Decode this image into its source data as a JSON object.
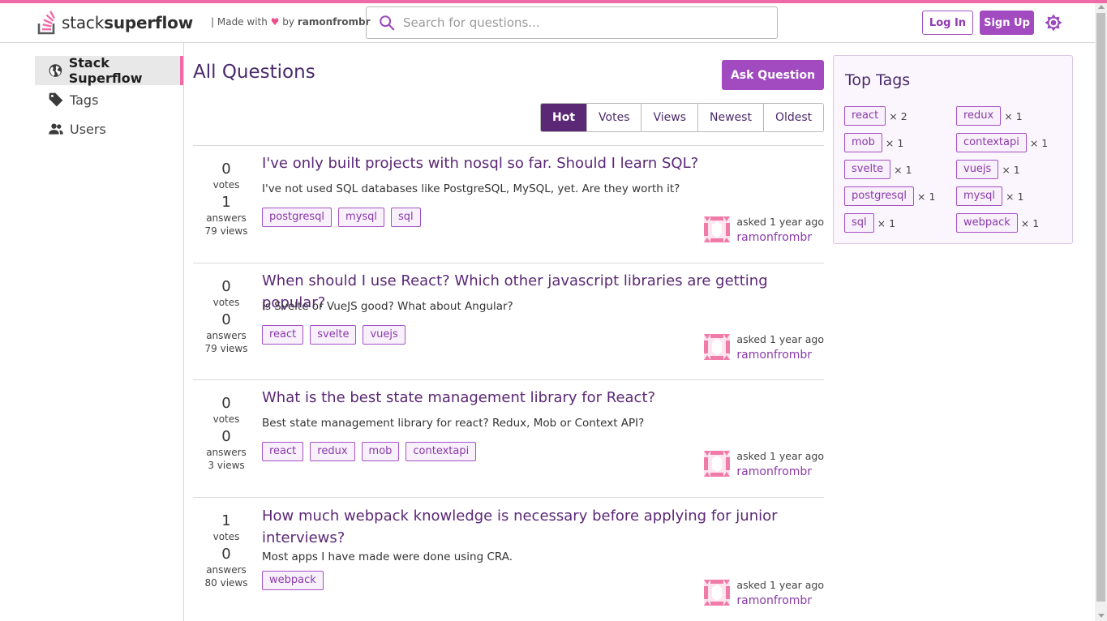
{
  "brand": {
    "name_light": "stack",
    "name_bold": "superflow",
    "made_with_prefix": "| Made with",
    "heart": "♥",
    "by": "by",
    "author": "ramonfrombr"
  },
  "search": {
    "placeholder": "Search for questions..."
  },
  "auth": {
    "login": "Log In",
    "signup": "Sign Up"
  },
  "icons": {
    "logo": "stack-logo-icon",
    "search": "search-icon",
    "theme": "brightness-icon",
    "globe": "globe-icon",
    "tag": "tag-icon",
    "users": "users-icon"
  },
  "colors": {
    "accent": "#a24bc0",
    "pink": "#f06aa8",
    "dark_purple": "#5b2876"
  },
  "sidebar": {
    "items": [
      {
        "label": "Stack Superflow"
      },
      {
        "label": "Tags"
      },
      {
        "label": "Users"
      }
    ]
  },
  "main": {
    "title": "All Questions",
    "ask_button": "Ask Question",
    "sort": [
      "Hot",
      "Votes",
      "Views",
      "Newest",
      "Oldest"
    ],
    "sort_active": "Hot",
    "questions": [
      {
        "votes": "0",
        "votes_label": "votes",
        "answers": "1",
        "answers_label": "answers",
        "views": "79 views",
        "title": "I've only built projects with nosql so far. Should I learn SQL?",
        "body": "I've not used SQL databases like PostgreSQL, MySQL, yet. Are they worth it?",
        "tags": [
          "postgresql",
          "mysql",
          "sql"
        ],
        "asked": "asked 1 year ago",
        "user": "ramonfrombr"
      },
      {
        "votes": "0",
        "votes_label": "votes",
        "answers": "0",
        "answers_label": "answers",
        "views": "79 views",
        "title": "When should I use React? Which other javascript libraries are getting popular?",
        "body": "Is Svelte or VueJS good? What about Angular?",
        "tags": [
          "react",
          "svelte",
          "vuejs"
        ],
        "asked": "asked 1 year ago",
        "user": "ramonfrombr"
      },
      {
        "votes": "0",
        "votes_label": "votes",
        "answers": "0",
        "answers_label": "answers",
        "views": "3 views",
        "title": "What is the best state management library for React?",
        "body": "Best state management library for react? Redux, Mob or Context API?",
        "tags": [
          "react",
          "redux",
          "mob",
          "contextapi"
        ],
        "asked": "asked 1 year ago",
        "user": "ramonfrombr"
      },
      {
        "votes": "1",
        "votes_label": "votes",
        "answers": "0",
        "answers_label": "answers",
        "views": "80 views",
        "title": "How much webpack knowledge is necessary before applying for junior interviews?",
        "body": "Most apps I have made were done using CRA.",
        "tags": [
          "webpack"
        ],
        "asked": "asked 1 year ago",
        "user": "ramonfrombr"
      }
    ]
  },
  "top_tags": {
    "title": "Top Tags",
    "items": [
      {
        "tag": "react",
        "count": "× 2"
      },
      {
        "tag": "redux",
        "count": "× 1"
      },
      {
        "tag": "mob",
        "count": "× 1"
      },
      {
        "tag": "contextapi",
        "count": "× 1"
      },
      {
        "tag": "svelte",
        "count": "× 1"
      },
      {
        "tag": "vuejs",
        "count": "× 1"
      },
      {
        "tag": "postgresql",
        "count": "× 1"
      },
      {
        "tag": "mysql",
        "count": "× 1"
      },
      {
        "tag": "sql",
        "count": "× 1"
      },
      {
        "tag": "webpack",
        "count": "× 1"
      }
    ]
  }
}
